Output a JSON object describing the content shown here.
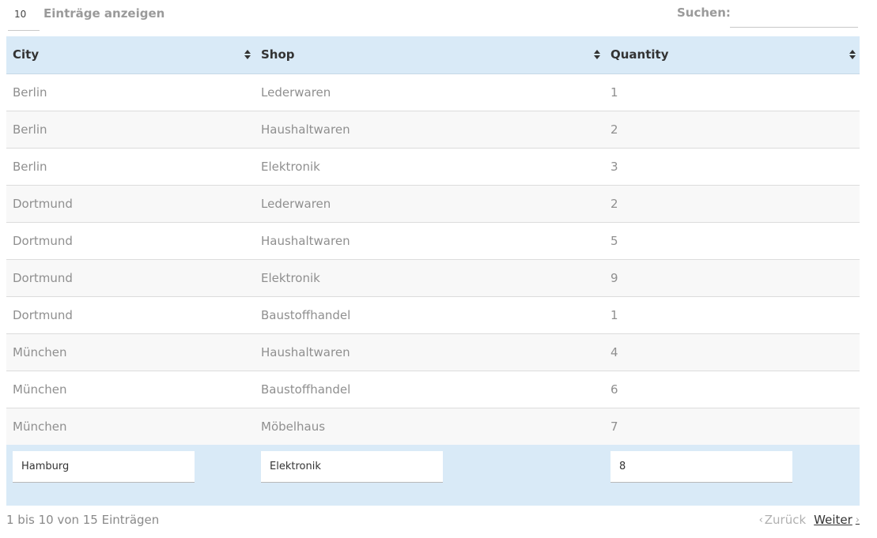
{
  "length": {
    "value": "10",
    "label": "Einträge anzeigen"
  },
  "search": {
    "label": "Suchen:",
    "value": ""
  },
  "table": {
    "headers": [
      "City",
      "Shop",
      "Quantity"
    ],
    "rows": [
      [
        "Berlin",
        "Lederwaren",
        "1"
      ],
      [
        "Berlin",
        "Haushaltwaren",
        "2"
      ],
      [
        "Berlin",
        "Elektronik",
        "3"
      ],
      [
        "Dortmund",
        "Lederwaren",
        "2"
      ],
      [
        "Dortmund",
        "Haushaltwaren",
        "5"
      ],
      [
        "Dortmund",
        "Elektronik",
        "9"
      ],
      [
        "Dortmund",
        "Baustoffhandel",
        "1"
      ],
      [
        "München",
        "Haushaltwaren",
        "4"
      ],
      [
        "München",
        "Baustoffhandel",
        "6"
      ],
      [
        "München",
        "Möbelhaus",
        "7"
      ]
    ]
  },
  "edit_row": {
    "city": "Hamburg",
    "shop": "Elektronik",
    "quantity": "8"
  },
  "info": "1 bis 10 von 15 Einträgen",
  "pagination": {
    "prev": "Zurück",
    "next": "Weiter"
  },
  "colors": {
    "header_bg": "#d9eaf7",
    "edit_row_bg": "#d9eaf7",
    "stripe": "#f8f8f8"
  },
  "icons": {
    "sort": "sort-both-icon",
    "prev": "chevron-left-icon",
    "next": "chevron-right-icon"
  }
}
